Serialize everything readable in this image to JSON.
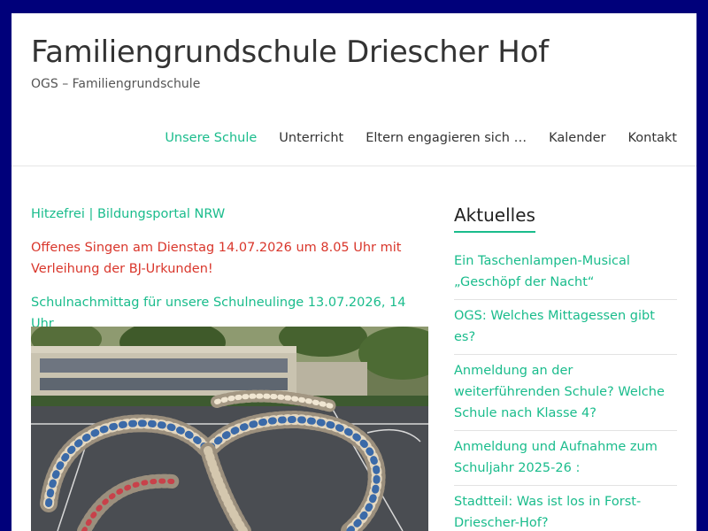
{
  "site": {
    "title": "Familiengrundschule Driescher Hof",
    "description": "OGS – Familiengrundschule"
  },
  "nav": {
    "items": [
      {
        "label": "Unsere Schule",
        "active": true
      },
      {
        "label": "Unterricht",
        "active": false
      },
      {
        "label": "Eltern engagieren sich …",
        "active": false
      },
      {
        "label": "Kalender",
        "active": false
      },
      {
        "label": "Kontakt",
        "active": false
      }
    ]
  },
  "main": {
    "links": [
      {
        "text": "Hitzefrei | Bildungsportal NRW",
        "color": "#1abc8c"
      },
      {
        "text": "Offenes Singen am Dienstag 14.07.2026 um 8.05 Uhr mit Verleihung der BJ-Urkunden!",
        "color": "#d9362b"
      },
      {
        "text": "Schulnachmittag für unsere Schulneulinge 13.07.2026, 14 Uhr",
        "color": "#1abc8c"
      }
    ]
  },
  "sidebar": {
    "title": "Aktuelles",
    "items": [
      {
        "label": "Ein Taschenlampen-Musical „Geschöpf der Nacht“"
      },
      {
        "label": "OGS: Welches Mittagessen gibt es?"
      },
      {
        "label": "Anmeldung an der weiterführenden Schule? Welche Schule nach Klasse 4?"
      },
      {
        "label": "Anmeldung und Aufnahme zum Schuljahr 2025-26 :"
      },
      {
        "label": "Stadtteil: Was ist los in Forst-Driescher-Hof?"
      }
    ]
  },
  "colors": {
    "accent": "#1abc8c",
    "alert": "#d9362b",
    "frame": "#00007a"
  }
}
